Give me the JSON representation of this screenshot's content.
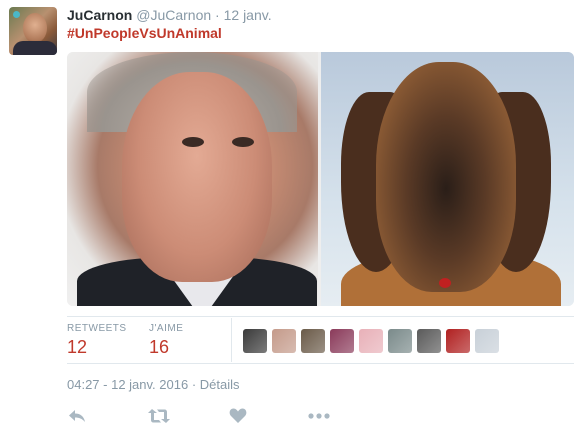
{
  "tweet": {
    "name": "JuCarnon",
    "handle": "@JuCarnon",
    "separator": "·",
    "date": "12 janv.",
    "hashtag": "#UnPeopleVsUnAnimal",
    "stats": {
      "retweets_label": "RETWEETS",
      "retweets_count": "12",
      "likes_label": "J'AIME",
      "likes_count": "16"
    },
    "timestamp": "04:27 - 12 janv. 2016",
    "timestamp_sep": "·",
    "details_link": "Détails"
  },
  "likers": [
    {
      "name": "liker-avatar-1",
      "color": "#3a3a3a"
    },
    {
      "name": "liker-avatar-2",
      "color": "#c49a8a"
    },
    {
      "name": "liker-avatar-3",
      "color": "#6a5a48"
    },
    {
      "name": "liker-avatar-4",
      "color": "#8a3a5a"
    },
    {
      "name": "liker-avatar-5",
      "color": "#e8b0b8"
    },
    {
      "name": "liker-avatar-6",
      "color": "#7a8a8a"
    },
    {
      "name": "liker-avatar-7",
      "color": "#5a5a5a"
    },
    {
      "name": "liker-avatar-8",
      "color": "#b02020"
    },
    {
      "name": "liker-avatar-9",
      "color": "#c8d0d8"
    }
  ],
  "actions": [
    "reply-icon",
    "retweet-icon",
    "heart-icon",
    "more-icon"
  ],
  "colors": {
    "accent": "#c0392b",
    "muted": "#8899a6",
    "divider": "#e1e8ed"
  }
}
